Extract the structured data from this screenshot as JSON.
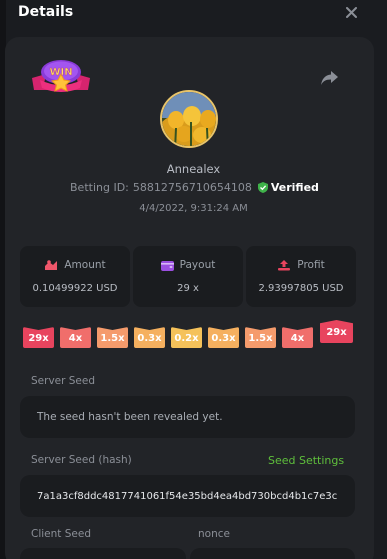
{
  "header": {
    "title": "Details"
  },
  "profile": {
    "username": "Annealex",
    "betting_id_label": "Betting ID:",
    "betting_id": "58812756710654108",
    "verified_label": "Verified",
    "datetime": "4/4/2022, 9:31:24 AM",
    "badge_text": "WIN"
  },
  "stats": {
    "amount": {
      "label": "Amount",
      "value": "0.10499922 USD"
    },
    "payout": {
      "label": "Payout",
      "value": "29 x"
    },
    "profit": {
      "label": "Profit",
      "value": "2.93997805 USD"
    }
  },
  "multipliers": [
    "29x",
    "4x",
    "1.5x",
    "0.3x",
    "0.2x",
    "0.3x",
    "1.5x",
    "4x",
    "29x"
  ],
  "colors": {
    "red": "#e8445e",
    "salmon": "#f06e6b",
    "orange": "#f59b6c",
    "amber": "#f5b05f",
    "yellow": "#f5c25a",
    "green": "#5fbf3c"
  },
  "seeds": {
    "server_seed_label": "Server Seed",
    "server_seed_value": "The seed hasn't been revealed yet.",
    "server_hash_label": "Server Seed (hash)",
    "seed_settings_label": "Seed Settings",
    "server_hash_value": "7a1a3cf8ddc4817741061f54e35bd4ea4bd730bcd4b1c7e3c",
    "client_seed_label": "Client Seed",
    "nonce_label": "nonce"
  }
}
